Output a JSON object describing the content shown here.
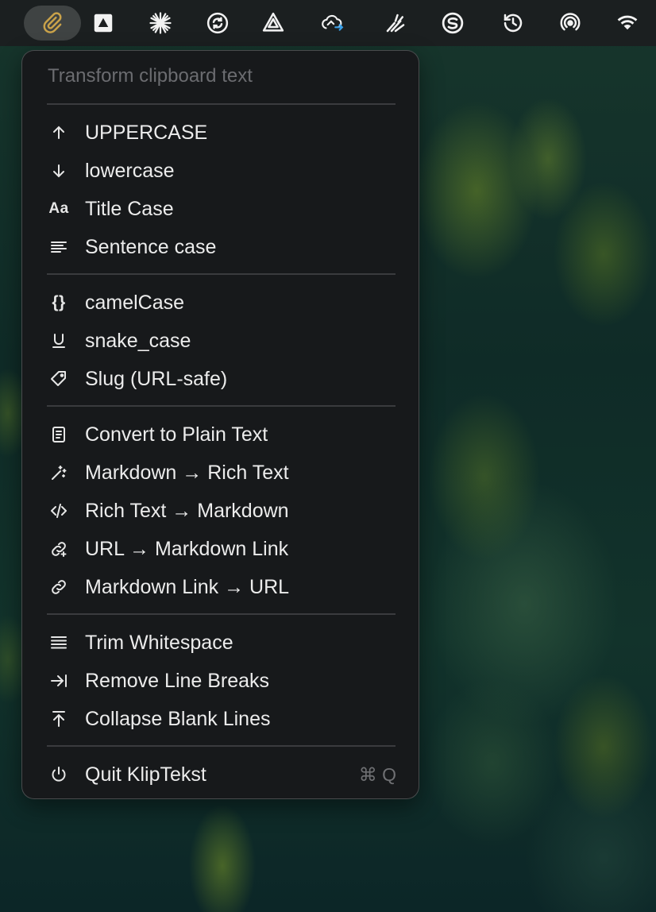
{
  "menubar": {
    "icons": [
      "paperclip-icon",
      "google-drive-icon",
      "asterisk-burst-icon",
      "sync-icon",
      "triangle-logo-icon",
      "cloud-sync-icon",
      "bolt-logo-icon",
      "s-logo-icon",
      "history-clock-icon",
      "airdrop-icon",
      "wifi-icon"
    ],
    "active_color": "#c9a24a"
  },
  "menu": {
    "header": "Transform clipboard text",
    "groups": [
      [
        {
          "icon": "arrow-up-icon",
          "label": "UPPERCASE"
        },
        {
          "icon": "arrow-down-icon",
          "label": "lowercase"
        },
        {
          "icon": "title-case-icon",
          "icon_text": "Aa",
          "label": "Title Case"
        },
        {
          "icon": "text-align-left-icon",
          "label": "Sentence case"
        }
      ],
      [
        {
          "icon": "curly-braces-icon",
          "icon_text": "{}",
          "label": "camelCase"
        },
        {
          "icon": "underline-icon",
          "icon_text": "U",
          "label": "snake_case"
        },
        {
          "icon": "tag-icon",
          "label": "Slug (URL-safe)"
        }
      ],
      [
        {
          "icon": "document-icon",
          "label": "Convert to Plain Text"
        },
        {
          "icon": "magic-wand-icon",
          "label": "Markdown → Rich Text"
        },
        {
          "icon": "code-icon",
          "label": "Rich Text → Markdown"
        },
        {
          "icon": "link-plus-icon",
          "label": "URL → Markdown Link"
        },
        {
          "icon": "link-icon",
          "label": "Markdown Link → URL"
        }
      ],
      [
        {
          "icon": "lines-icon",
          "label": "Trim Whitespace"
        },
        {
          "icon": "arrow-right-bar-icon",
          "label": "Remove Line Breaks"
        },
        {
          "icon": "arrow-up-bar-icon",
          "label": "Collapse Blank Lines"
        }
      ],
      [
        {
          "icon": "power-icon",
          "label": "Quit KlipTekst",
          "shortcut": "⌘ Q"
        }
      ]
    ]
  }
}
